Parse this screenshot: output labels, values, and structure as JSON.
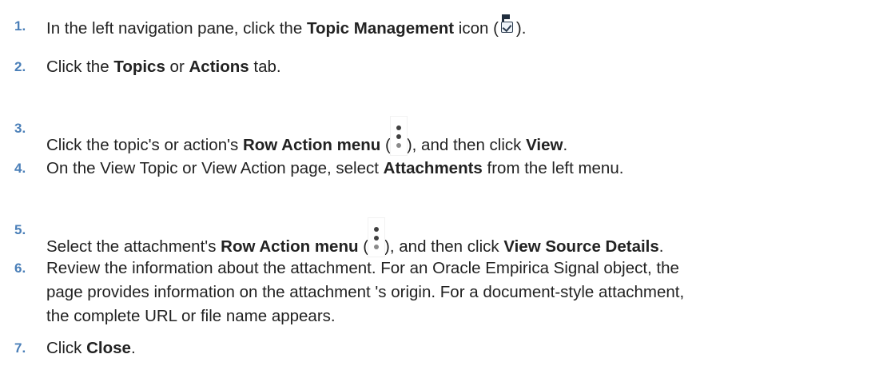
{
  "steps": [
    {
      "number": "1.",
      "parts": [
        "In the left navigation pane, click the ",
        "Topic Management",
        " icon (",
        ")."
      ]
    },
    {
      "number": "2.",
      "parts": [
        "Click the ",
        "Topics",
        " or ",
        "Actions",
        " tab."
      ]
    },
    {
      "number": "3.",
      "parts": [
        "Click the topic's or action's ",
        "Row Action menu",
        " (",
        "), and then click ",
        "View",
        "."
      ]
    },
    {
      "number": "4.",
      "parts": [
        "On the View Topic or View Action page, select ",
        "Attachments",
        " from the left menu."
      ]
    },
    {
      "number": "5.",
      "parts": [
        "Select the attachment's ",
        "Row Action menu",
        " (",
        "), and then click ",
        "View Source Details",
        "."
      ]
    },
    {
      "number": "6.",
      "lines": [
        "Review the information about the attachment. For an Oracle Empirica Signal object, the",
        "page provides information on the attachment 's origin. For a document-style attachment,",
        "the complete URL or file name appears."
      ]
    },
    {
      "number": "7.",
      "parts": [
        "Click ",
        "Close",
        "."
      ]
    }
  ],
  "icons": {
    "topic_management": "topic-management-icon",
    "row_action_menu": "kebab-menu-icon"
  },
  "colors": {
    "step_number": "#4a7fb8",
    "text": "#222222"
  }
}
